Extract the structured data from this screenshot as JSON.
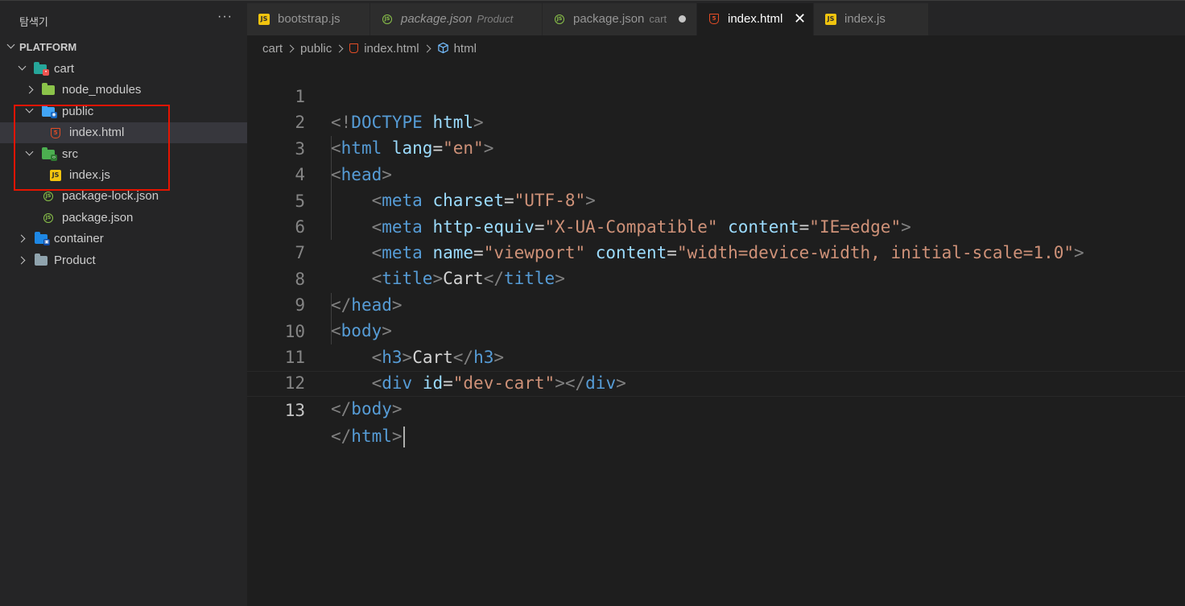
{
  "explorer": {
    "title": "탐색기",
    "more_label": "···",
    "tree": [
      {
        "label": "PLATFORM"
      },
      {
        "label": "cart"
      },
      {
        "label": "node_modules"
      },
      {
        "label": "public"
      },
      {
        "label": "index.html"
      },
      {
        "label": "src"
      },
      {
        "label": "index.js"
      },
      {
        "label": "package-lock.json"
      },
      {
        "label": "package.json"
      },
      {
        "label": "container"
      },
      {
        "label": "Product"
      }
    ]
  },
  "tabs": [
    {
      "label": "bootstrap.js",
      "icon": "js-file-icon"
    },
    {
      "label": "package.json",
      "description": "Product",
      "icon": "nodejs-file-icon",
      "italic": true
    },
    {
      "label": "package.json",
      "description": "cart",
      "icon": "nodejs-file-icon",
      "modified": true
    },
    {
      "label": "index.html",
      "icon": "html5-file-icon",
      "active": true,
      "close_glyph": "✕"
    },
    {
      "label": "index.js",
      "icon": "js-file-icon"
    }
  ],
  "breadcrumb": [
    "cart",
    "public",
    "index.html",
    "html"
  ],
  "editor": {
    "current_line": 13,
    "lines": [
      {
        "n": "1"
      },
      {
        "n": "2"
      },
      {
        "n": "3"
      },
      {
        "n": "4"
      },
      {
        "n": "5"
      },
      {
        "n": "6"
      },
      {
        "n": "7"
      },
      {
        "n": "8"
      },
      {
        "n": "9"
      },
      {
        "n": "10"
      },
      {
        "n": "11"
      },
      {
        "n": "12"
      },
      {
        "n": "13"
      }
    ],
    "tokens": {
      "l1": [
        "<!",
        "DOCTYPE",
        " html",
        ">"
      ],
      "l2": [
        "<",
        "html",
        " lang",
        "=",
        "\"en\"",
        ">"
      ],
      "l3": [
        "<",
        "head",
        ">"
      ],
      "l4": [
        "    ",
        "<",
        "meta",
        " charset",
        "=",
        "\"UTF-8\"",
        ">"
      ],
      "l5": [
        "    ",
        "<",
        "meta",
        " http-equiv",
        "=",
        "\"X-UA-Compatible\"",
        " content",
        "=",
        "\"IE=edge\"",
        ">"
      ],
      "l6": [
        "    ",
        "<",
        "meta",
        " name",
        "=",
        "\"viewport\"",
        " content",
        "=",
        "\"width=device-width, initial-scale=1.0\"",
        ">"
      ],
      "l7": [
        "    ",
        "<",
        "title",
        ">",
        "Cart",
        "</",
        "title",
        ">"
      ],
      "l8": [
        "</",
        "head",
        ">"
      ],
      "l9": [
        "<",
        "body",
        ">"
      ],
      "l10": [
        "    ",
        "<",
        "h3",
        ">",
        "Cart",
        "</",
        "h3",
        ">"
      ],
      "l11": [
        "    ",
        "<",
        "div",
        " id",
        "=",
        "\"dev-cart\"",
        ">",
        "</",
        "div",
        ">"
      ],
      "l12": [
        "</",
        "body",
        ">"
      ],
      "l13": [
        "</",
        "html",
        ">"
      ]
    }
  },
  "colors": {
    "tag": "#569cd6",
    "attribute": "#9cdcfe",
    "string": "#ce9178",
    "punctuation": "#808080",
    "text": "#d4d4d4",
    "highlight_box": "#e51400"
  }
}
